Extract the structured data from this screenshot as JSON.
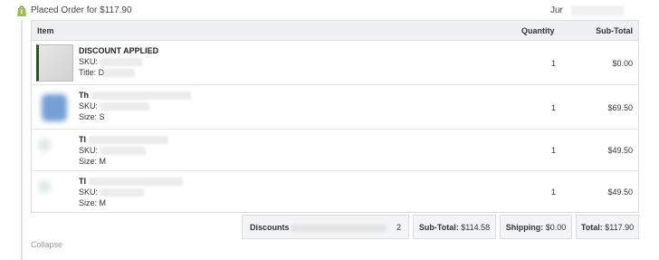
{
  "header": {
    "title": "Placed Order for $117.90",
    "date_prefix": "Jur",
    "brand_color": "#95bf47"
  },
  "table": {
    "columns": {
      "item": "Item",
      "quantity": "Quantity",
      "subtotal": "Sub-Total"
    },
    "rows": [
      {
        "name": "DISCOUNT APPLIED",
        "sku_label": "SKU:",
        "detail_label": "Title: D",
        "quantity": "1",
        "subtotal": "$0.00",
        "thumbnail": "gray-swatch"
      },
      {
        "name": "Th",
        "sku_label": "SKU:",
        "detail_label": "Size: S",
        "quantity": "1",
        "subtotal": "$69.50",
        "thumbnail": "blue-shirt"
      },
      {
        "name": "Tl",
        "sku_label": "SKU:",
        "detail_label": "Size: M",
        "quantity": "1",
        "subtotal": "$49.50",
        "thumbnail": "faint-product"
      },
      {
        "name": "Tl",
        "sku_label": "SKU:",
        "detail_label": "Size: M",
        "quantity": "1",
        "subtotal": "$49.50",
        "thumbnail": "faint-product"
      }
    ]
  },
  "summary": {
    "discounts_label": "Discounts",
    "discounts_value": "2",
    "subtotal_label": "Sub-Total:",
    "subtotal_value": "$114.58",
    "shipping_label": "Shipping:",
    "shipping_value": "$0.00",
    "total_label": "Total:",
    "total_value": "$117.90"
  },
  "footer": {
    "collapse_label": "Collapse"
  }
}
